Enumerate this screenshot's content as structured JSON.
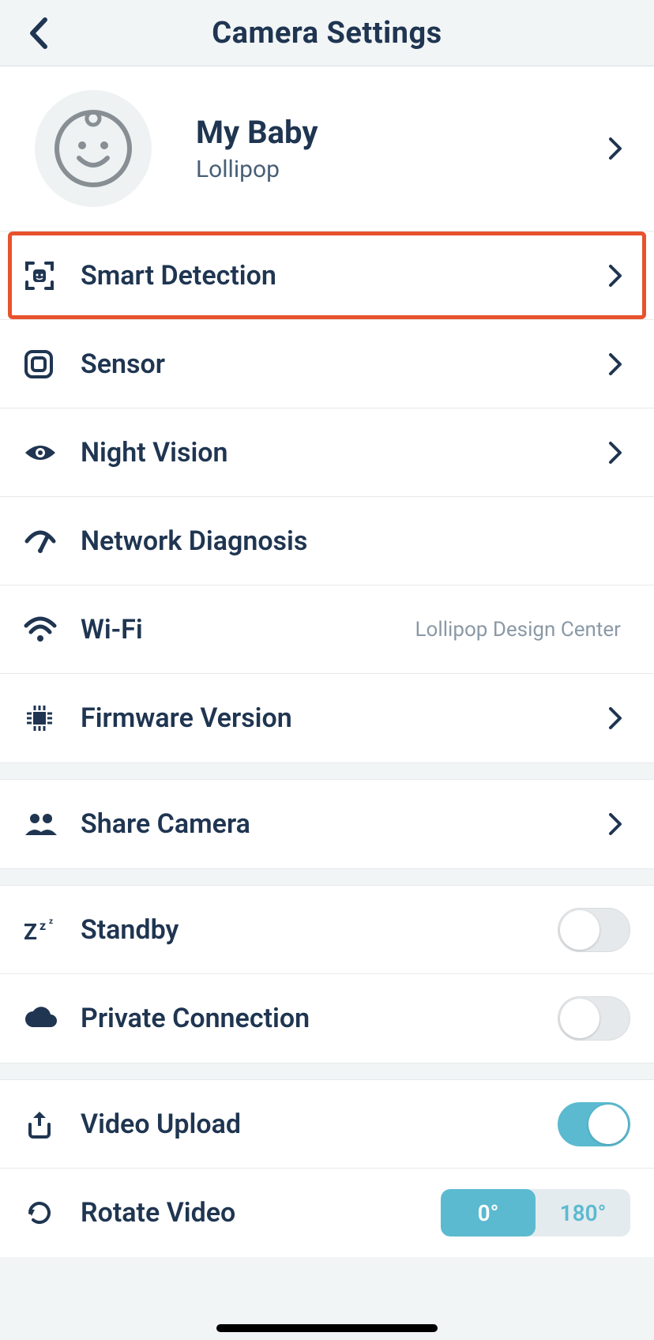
{
  "header": {
    "title": "Camera Settings"
  },
  "profile": {
    "name": "My Baby",
    "device": "Lollipop"
  },
  "rows": {
    "smart_detection": {
      "label": "Smart Detection"
    },
    "sensor": {
      "label": "Sensor"
    },
    "night_vision": {
      "label": "Night Vision"
    },
    "network_diagnosis": {
      "label": "Network Diagnosis"
    },
    "wifi": {
      "label": "Wi-Fi",
      "value": "Lollipop Design Center"
    },
    "firmware": {
      "label": "Firmware Version"
    },
    "share": {
      "label": "Share Camera"
    },
    "standby": {
      "label": "Standby",
      "on": false
    },
    "private_connection": {
      "label": "Private Connection",
      "on": false
    },
    "video_upload": {
      "label": "Video Upload",
      "on": true
    },
    "rotate": {
      "label": "Rotate Video",
      "options": [
        "0°",
        "180°"
      ],
      "selected": "0°"
    }
  }
}
